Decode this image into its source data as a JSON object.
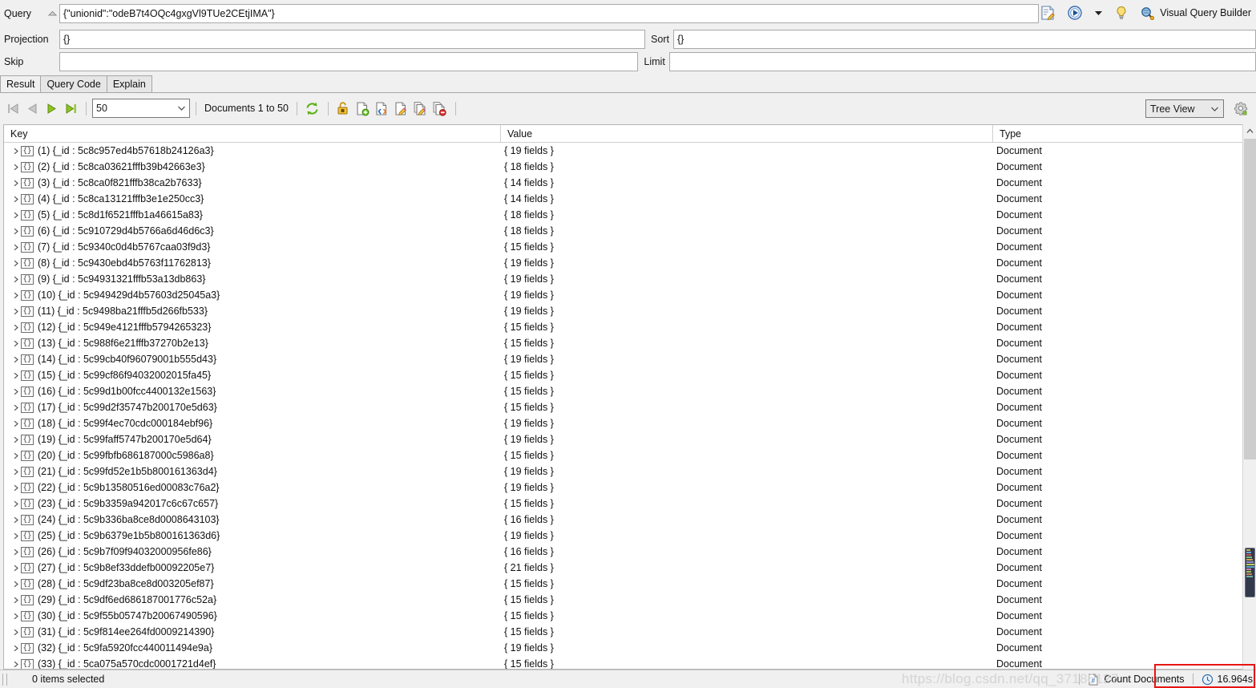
{
  "query_panel": {
    "query_label": "Query",
    "query_value": "{\"unionid\":\"odeB7t4OQc4gxgVl9TUe2CEtjIMA\"}",
    "projection_label": "Projection",
    "projection_value": "{}",
    "skip_label": "Skip",
    "skip_value": "",
    "sort_label": "Sort",
    "sort_value": "{}",
    "limit_label": "Limit",
    "limit_value": "",
    "visual_query_builder_label": "Visual Query Builder",
    "icons": {
      "collapse": "chevron-up-icon",
      "edit_query": "edit-query-icon",
      "run": "run-query-icon",
      "run_dropdown": "chevron-down-icon",
      "hint": "lightbulb-icon",
      "vqb": "visual-query-builder-icon"
    }
  },
  "tabs": [
    {
      "label": "Result",
      "active": true
    },
    {
      "label": "Query Code",
      "active": false
    },
    {
      "label": "Explain",
      "active": false
    }
  ],
  "result_toolbar": {
    "nav": [
      {
        "name": "first-page-button",
        "enabled": false
      },
      {
        "name": "previous-page-button",
        "enabled": false
      },
      {
        "name": "next-page-button",
        "enabled": true
      },
      {
        "name": "last-page-button",
        "enabled": true
      }
    ],
    "page_size": "50",
    "documents_range": "Documents 1 to 50",
    "buttons": [
      {
        "name": "refresh-button",
        "icon": "refresh-icon"
      },
      {
        "name": "unlock-button",
        "icon": "open-padlock-icon"
      },
      {
        "name": "add-document-button",
        "icon": "document-plus-icon"
      },
      {
        "name": "view-json-button",
        "icon": "document-code-icon"
      },
      {
        "name": "edit-document-button",
        "icon": "document-pencil-icon"
      },
      {
        "name": "edit-multiple-button",
        "icon": "documents-pencil-icon"
      },
      {
        "name": "delete-documents-button",
        "icon": "documents-delete-icon"
      }
    ],
    "view_mode": "Tree View",
    "view_settings_icon": "gear-icon"
  },
  "grid": {
    "columns": [
      "Key",
      "Value",
      "Type"
    ],
    "rows": [
      {
        "index": "(1)",
        "key": "{_id : 5c8c957ed4b57618b24126a3}",
        "value": "{ 19 fields }",
        "type": "Document"
      },
      {
        "index": "(2)",
        "key": "{_id : 5c8ca03621fffb39b42663e3}",
        "value": "{ 18 fields }",
        "type": "Document"
      },
      {
        "index": "(3)",
        "key": "{_id : 5c8ca0f821fffb38ca2b7633}",
        "value": "{ 14 fields }",
        "type": "Document"
      },
      {
        "index": "(4)",
        "key": "{_id : 5c8ca13121fffb3e1e250cc3}",
        "value": "{ 14 fields }",
        "type": "Document"
      },
      {
        "index": "(5)",
        "key": "{_id : 5c8d1f6521fffb1a46615a83}",
        "value": "{ 18 fields }",
        "type": "Document"
      },
      {
        "index": "(6)",
        "key": "{_id : 5c910729d4b5766a6d46d6c3}",
        "value": "{ 18 fields }",
        "type": "Document"
      },
      {
        "index": "(7)",
        "key": "{_id : 5c9340c0d4b5767caa03f9d3}",
        "value": "{ 15 fields }",
        "type": "Document"
      },
      {
        "index": "(8)",
        "key": "{_id : 5c9430ebd4b5763f11762813}",
        "value": "{ 19 fields }",
        "type": "Document"
      },
      {
        "index": "(9)",
        "key": "{_id : 5c94931321fffb53a13db863}",
        "value": "{ 19 fields }",
        "type": "Document"
      },
      {
        "index": "(10)",
        "key": "{_id : 5c949429d4b57603d25045a3}",
        "value": "{ 19 fields }",
        "type": "Document"
      },
      {
        "index": "(11)",
        "key": "{_id : 5c9498ba21fffb5d266fb533}",
        "value": "{ 19 fields }",
        "type": "Document"
      },
      {
        "index": "(12)",
        "key": "{_id : 5c949e4121fffb5794265323}",
        "value": "{ 15 fields }",
        "type": "Document"
      },
      {
        "index": "(13)",
        "key": "{_id : 5c988f6e21fffb37270b2e13}",
        "value": "{ 15 fields }",
        "type": "Document"
      },
      {
        "index": "(14)",
        "key": "{_id : 5c99cb40f96079001b555d43}",
        "value": "{ 19 fields }",
        "type": "Document"
      },
      {
        "index": "(15)",
        "key": "{_id : 5c99cf86f94032002015fa45}",
        "value": "{ 15 fields }",
        "type": "Document"
      },
      {
        "index": "(16)",
        "key": "{_id : 5c99d1b00fcc4400132e1563}",
        "value": "{ 15 fields }",
        "type": "Document"
      },
      {
        "index": "(17)",
        "key": "{_id : 5c99d2f35747b200170e5d63}",
        "value": "{ 15 fields }",
        "type": "Document"
      },
      {
        "index": "(18)",
        "key": "{_id : 5c99f4ec70cdc000184ebf96}",
        "value": "{ 19 fields }",
        "type": "Document"
      },
      {
        "index": "(19)",
        "key": "{_id : 5c99faff5747b200170e5d64}",
        "value": "{ 19 fields }",
        "type": "Document"
      },
      {
        "index": "(20)",
        "key": "{_id : 5c99fbfb686187000c5986a8}",
        "value": "{ 15 fields }",
        "type": "Document"
      },
      {
        "index": "(21)",
        "key": "{_id : 5c99fd52e1b5b800161363d4}",
        "value": "{ 19 fields }",
        "type": "Document"
      },
      {
        "index": "(22)",
        "key": "{_id : 5c9b13580516ed00083c76a2}",
        "value": "{ 19 fields }",
        "type": "Document"
      },
      {
        "index": "(23)",
        "key": "{_id : 5c9b3359a942017c6c67c657}",
        "value": "{ 15 fields }",
        "type": "Document"
      },
      {
        "index": "(24)",
        "key": "{_id : 5c9b336ba8ce8d0008643103}",
        "value": "{ 16 fields }",
        "type": "Document"
      },
      {
        "index": "(25)",
        "key": "{_id : 5c9b6379e1b5b800161363d6}",
        "value": "{ 19 fields }",
        "type": "Document"
      },
      {
        "index": "(26)",
        "key": "{_id : 5c9b7f09f94032000956fe86}",
        "value": "{ 16 fields }",
        "type": "Document"
      },
      {
        "index": "(27)",
        "key": "{_id : 5c9b8ef33ddefb00092205e7}",
        "value": "{ 21 fields }",
        "type": "Document"
      },
      {
        "index": "(28)",
        "key": "{_id : 5c9df23ba8ce8d003205ef87}",
        "value": "{ 15 fields }",
        "type": "Document"
      },
      {
        "index": "(29)",
        "key": "{_id : 5c9df6ed686187001776c52a}",
        "value": "{ 15 fields }",
        "type": "Document"
      },
      {
        "index": "(30)",
        "key": "{_id : 5c9f55b05747b20067490596}",
        "value": "{ 15 fields }",
        "type": "Document"
      },
      {
        "index": "(31)",
        "key": "{_id : 5c9f814ee264fd0009214390}",
        "value": "{ 15 fields }",
        "type": "Document"
      },
      {
        "index": "(32)",
        "key": "{_id : 5c9fa5920fcc440011494e9a}",
        "value": "{ 19 fields }",
        "type": "Document"
      },
      {
        "index": "(33)",
        "key": "{_id : 5ca075a570cdc0001721d4ef}",
        "value": "{ 15 fields }",
        "type": "Document"
      }
    ]
  },
  "status_bar": {
    "selection": "0 items selected",
    "count_documents_label": "Count Documents",
    "count_icon": "hash-document-icon",
    "timing": "16.964s",
    "timing_icon": "clock-icon"
  },
  "watermark": {
    "text": "https://blog.csdn.net/qq_37186127"
  },
  "colors": {
    "accent_green": "#79c000",
    "highlight_red": "#e81414",
    "panel_bg": "#f0f0f0",
    "grid_bg": "#ffffff"
  }
}
